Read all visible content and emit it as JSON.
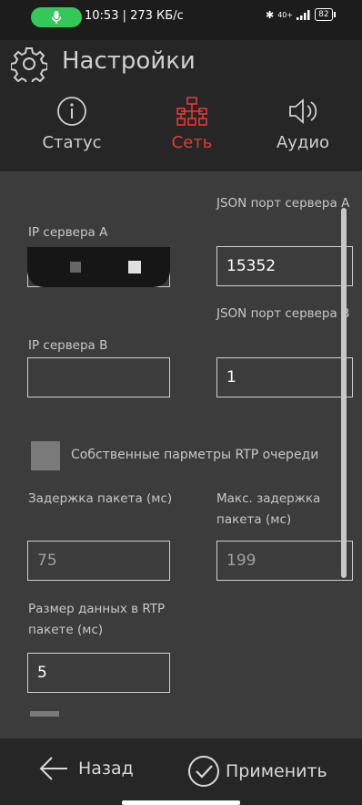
{
  "status_bar": {
    "time_speed": "10:53 | 273 КБ/с",
    "signal_text": "40+",
    "battery": "82"
  },
  "header": {
    "title": "Настройки"
  },
  "tabs": [
    {
      "label": "Статус",
      "icon": "info-icon",
      "active": false
    },
    {
      "label": "Сеть",
      "icon": "network-icon",
      "active": true
    },
    {
      "label": "Аудио",
      "icon": "speaker-icon",
      "active": false
    }
  ],
  "form": {
    "server_a_ip_label": "IP сервера А",
    "server_a_ip_value": "",
    "server_a_json_port_label": "JSON порт сервера А",
    "server_a_json_port_value": "15352",
    "server_b_ip_label": "IP сервера B",
    "server_b_ip_value": "",
    "server_b_json_port_label": "JSON порт сервера B",
    "server_b_json_port_value": "1",
    "rtp_queue_checkbox_label": "Собственные парметры RTP очереди",
    "rtp_queue_checked": false,
    "packet_delay_label": "Задержка пакета (мс)",
    "packet_delay_value": "75",
    "max_packet_delay_label": "Макс. задержка пакета (мс)",
    "max_packet_delay_value": "199",
    "rtp_data_size_label": "Размер данных в RTP пакете (мс)",
    "rtp_data_size_value": "5"
  },
  "bottom": {
    "back_label": "Назад",
    "apply_label": "Применить"
  },
  "colors": {
    "accent": "#e53935",
    "header_bg": "#262626",
    "content_bg": "#3c3c3c",
    "mic_pill": "#34c759"
  }
}
